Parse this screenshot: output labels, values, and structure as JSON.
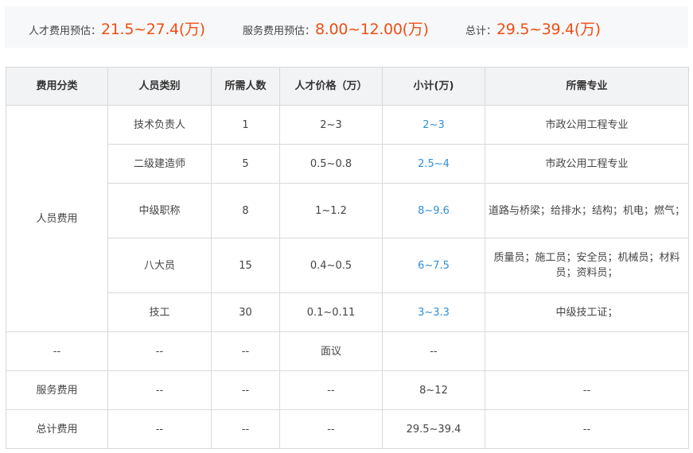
{
  "summary": {
    "talent": {
      "label": "人才费用预估：",
      "value": "21.5~27.4(万)"
    },
    "service": {
      "label": "服务费用预估：",
      "value": "8.00~12.00(万)"
    },
    "total": {
      "label": "总计：",
      "value": "29.5~39.4(万)"
    }
  },
  "colors": {
    "accent": "#f04e12",
    "subtotal": "#2f8fd8",
    "header_bg": "#f2f3f5"
  },
  "table": {
    "headers": [
      "费用分类",
      "人员类别",
      "所需人数",
      "人才价格（万）",
      "小计(万)",
      "所需专业"
    ],
    "personnel_category": "人员费用",
    "personnel_rows": [
      {
        "type": "技术负责人",
        "count": "1",
        "price": "2~3",
        "subtotal": "2~3",
        "major": "市政公用工程专业"
      },
      {
        "type": "二级建造师",
        "count": "5",
        "price": "0.5~0.8",
        "subtotal": "2.5~4",
        "major": "市政公用工程专业"
      },
      {
        "type": "中级职称",
        "count": "8",
        "price": "1~1.2",
        "subtotal": "8~9.6",
        "major": "道路与桥梁；给排水；结构；机电；燃气；"
      },
      {
        "type": "八大员",
        "count": "15",
        "price": "0.4~0.5",
        "subtotal": "6~7.5",
        "major": "质量员；施工员；安全员；机械员；材料员；资料员；"
      },
      {
        "type": "技工",
        "count": "30",
        "price": "0.1~0.11",
        "subtotal": "3~3.3",
        "major": "中级技工证；"
      }
    ],
    "extra_rows": [
      {
        "category": "--",
        "type": "--",
        "count": "--",
        "price": "面议",
        "subtotal": "--",
        "major": ""
      },
      {
        "category": "服务费用",
        "type": "--",
        "count": "--",
        "price": "--",
        "subtotal": "8~12",
        "major": "--"
      },
      {
        "category": "总计费用",
        "type": "--",
        "count": "--",
        "price": "--",
        "subtotal": "29.5~39.4",
        "major": "--"
      }
    ]
  }
}
